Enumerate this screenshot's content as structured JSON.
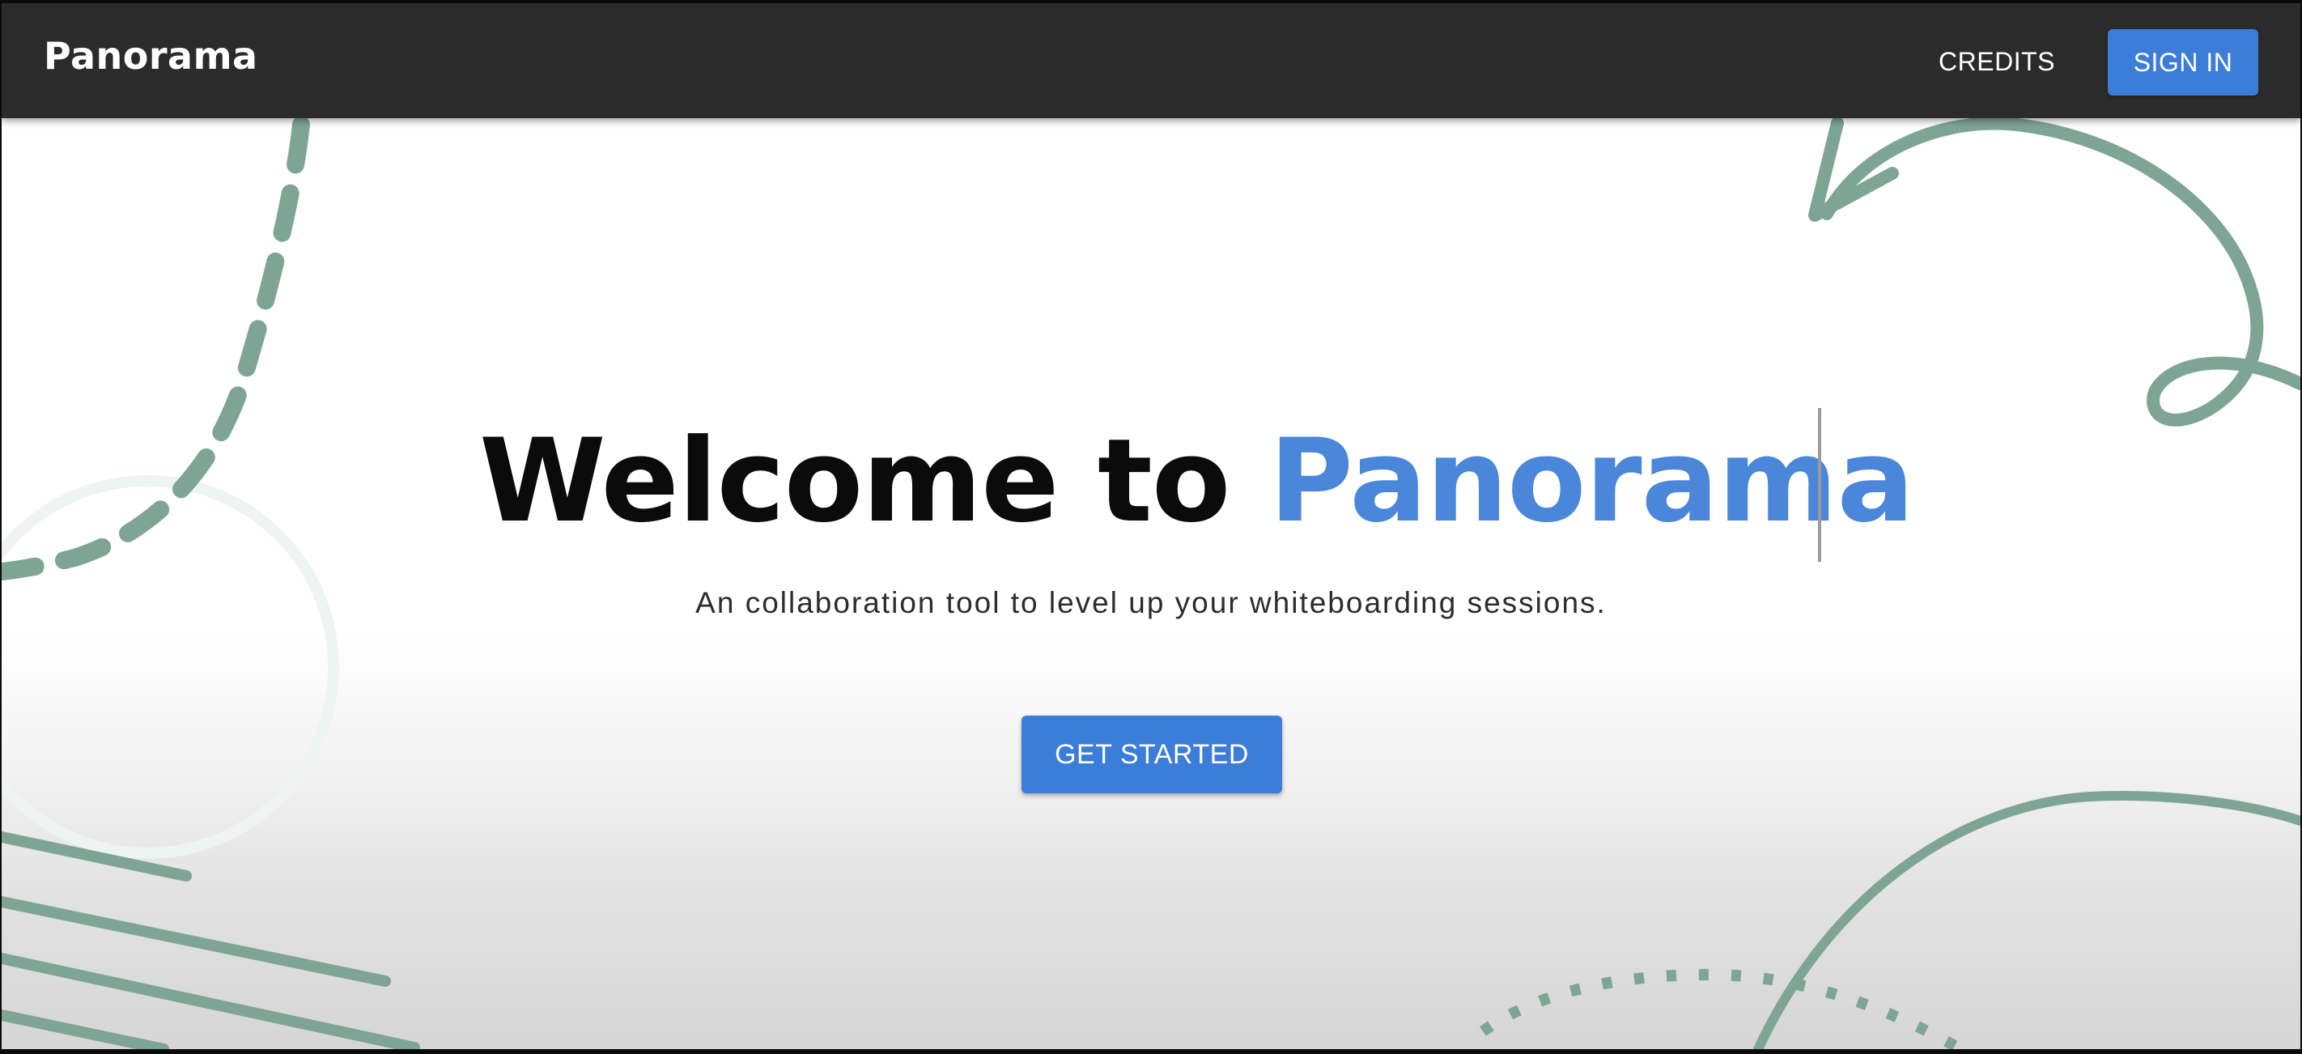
{
  "navbar": {
    "brand": "Panorama",
    "credits_label": "CREDITS",
    "signin_label": "SIGN IN"
  },
  "hero": {
    "title_prefix": "Welcome to ",
    "title_accent": "Panorama",
    "subtitle": "An collaboration tool to level up your whiteboarding sessions.",
    "cta_label": "GET STARTED"
  },
  "colors": {
    "navbar_bg": "#2b2b2b",
    "accent_blue": "#3b7dd8",
    "title_accent": "#4a86da",
    "decoration_green": "#7ea594"
  }
}
